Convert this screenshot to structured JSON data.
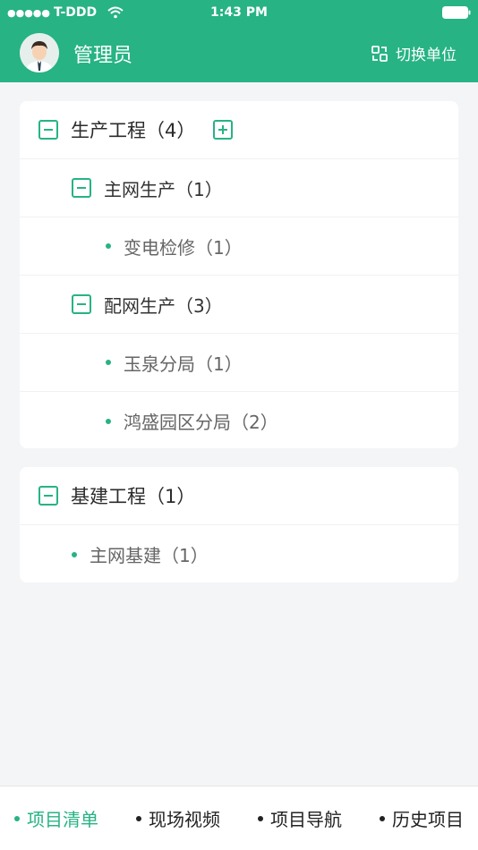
{
  "status_bar": {
    "carrier": "T-DDD",
    "time": "1:43 PM"
  },
  "header": {
    "title": "管理员",
    "switch_label": "切换单位"
  },
  "tree": [
    {
      "label": "生产工程（4）",
      "children": [
        {
          "label": "主网生产（1）",
          "children": [
            {
              "label": "变电检修（1）"
            }
          ]
        },
        {
          "label": "配网生产（3）",
          "children": [
            {
              "label": "玉泉分局（1）"
            },
            {
              "label": "鸿盛园区分局（2）"
            }
          ]
        }
      ]
    },
    {
      "label": "基建工程（1）",
      "children": [
        {
          "label": "主网基建（1）"
        }
      ]
    }
  ],
  "bottom_nav": {
    "items": [
      {
        "label": "项目清单",
        "active": true
      },
      {
        "label": "现场视频"
      },
      {
        "label": "项目导航"
      },
      {
        "label": "历史项目"
      }
    ]
  },
  "colors": {
    "accent": "#27b384",
    "background": "#f4f5f7"
  }
}
